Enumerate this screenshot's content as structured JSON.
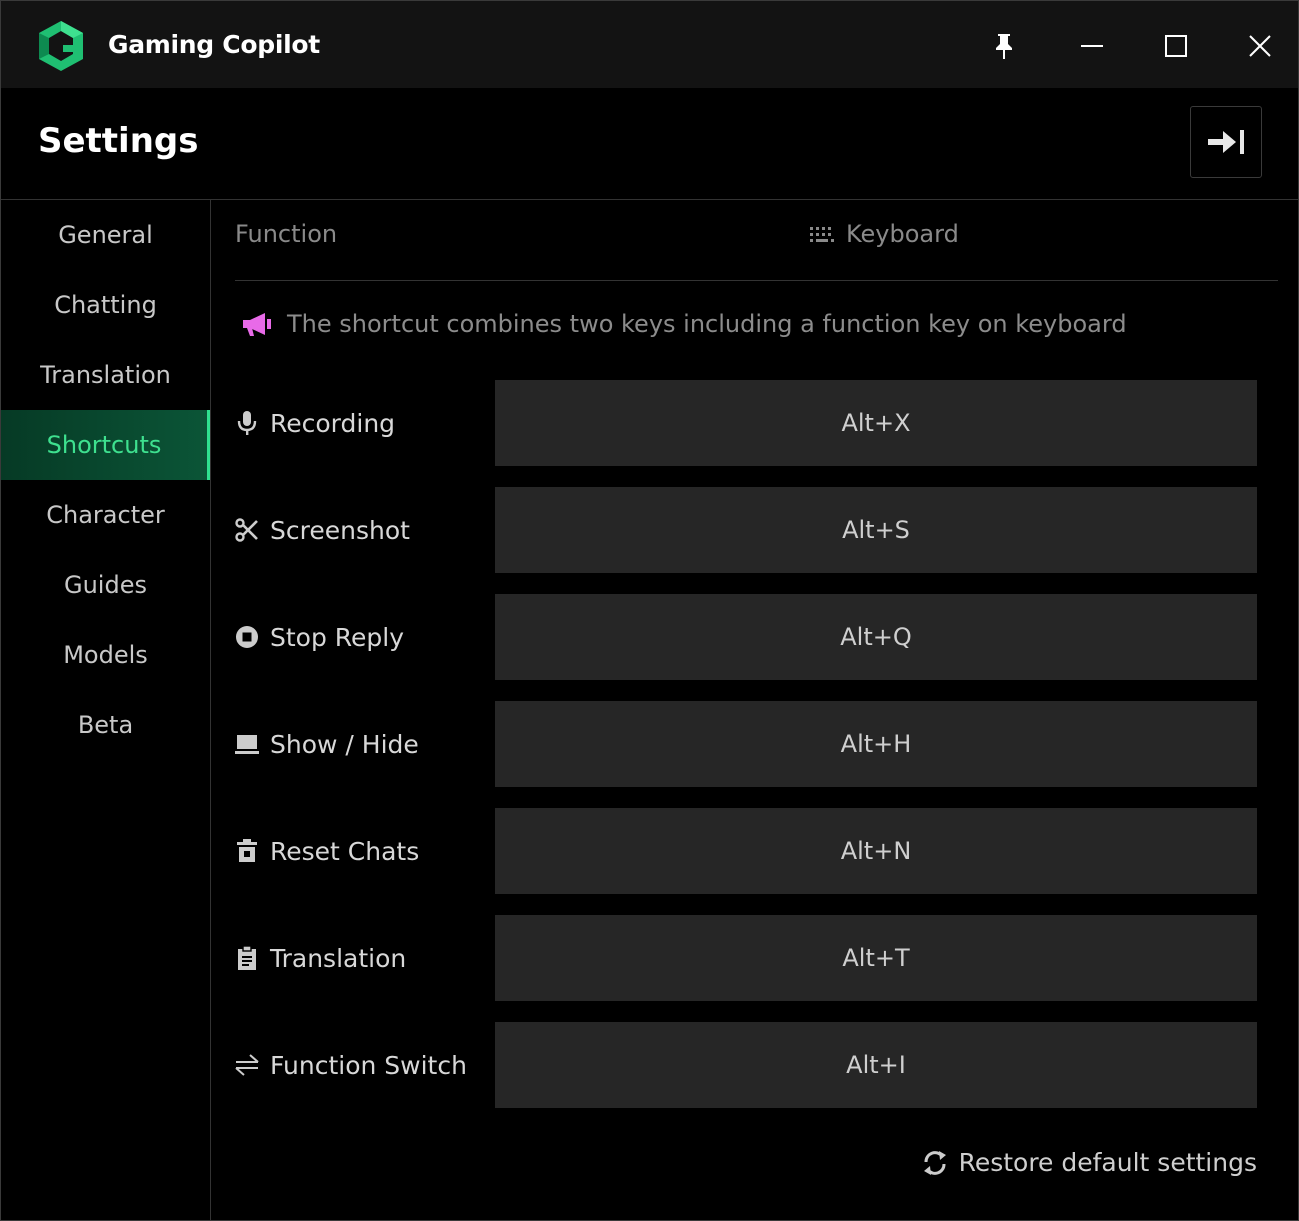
{
  "app": {
    "title": "Gaming Copilot",
    "accent": "#2fe08f"
  },
  "page": {
    "title": "Settings"
  },
  "nav": {
    "items": [
      {
        "label": "General"
      },
      {
        "label": "Chatting"
      },
      {
        "label": "Translation"
      },
      {
        "label": "Shortcuts",
        "active": true
      },
      {
        "label": "Character"
      },
      {
        "label": "Guides"
      },
      {
        "label": "Models"
      },
      {
        "label": "Beta"
      }
    ]
  },
  "table": {
    "function_header": "Function",
    "keyboard_header": "Keyboard"
  },
  "notice": {
    "text": "The shortcut combines two keys including a function key on keyboard",
    "icon": "megaphone-icon",
    "icon_color": "#e86ae8"
  },
  "shortcuts": [
    {
      "label": "Recording",
      "key": "Alt+X",
      "icon": "microphone-icon"
    },
    {
      "label": "Screenshot",
      "key": "Alt+S",
      "icon": "scissors-icon"
    },
    {
      "label": "Stop Reply",
      "key": "Alt+Q",
      "icon": "stop-circle-icon"
    },
    {
      "label": "Show / Hide",
      "key": "Alt+H",
      "icon": "laptop-icon"
    },
    {
      "label": "Reset Chats",
      "key": "Alt+N",
      "icon": "trash-icon"
    },
    {
      "label": "Translation",
      "key": "Alt+T",
      "icon": "clipboard-icon"
    },
    {
      "label": "Function Switch",
      "key": "Alt+I",
      "icon": "switch-arrows-icon"
    }
  ],
  "footer": {
    "restore_label": "Restore default settings"
  }
}
